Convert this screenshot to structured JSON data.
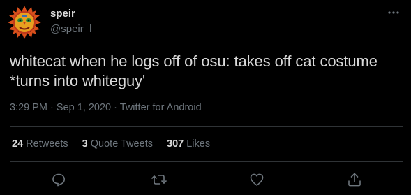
{
  "user": {
    "display_name": "speir",
    "handle": "@speir_l",
    "avatar_icon": "sun-mask-icon"
  },
  "tweet": {
    "text_line1": "whitecat when he logs off of osu: takes off cat costume",
    "text_line2": "*turns into whiteguy'",
    "time": "3:29 PM",
    "separator": "·",
    "date": "Sep 1, 2020",
    "source": "Twitter for Android"
  },
  "stats": {
    "retweets_count": "24",
    "retweets_label": "Retweets",
    "quotes_count": "3",
    "quotes_label": "Quote Tweets",
    "likes_count": "307",
    "likes_label": "Likes"
  },
  "actions": [
    "reply-icon",
    "retweet-icon",
    "like-icon",
    "share-icon"
  ],
  "colors": {
    "background": "#000000",
    "text": "#d9d9d9",
    "secondary": "#6e767d",
    "divider": "#2f3336"
  }
}
